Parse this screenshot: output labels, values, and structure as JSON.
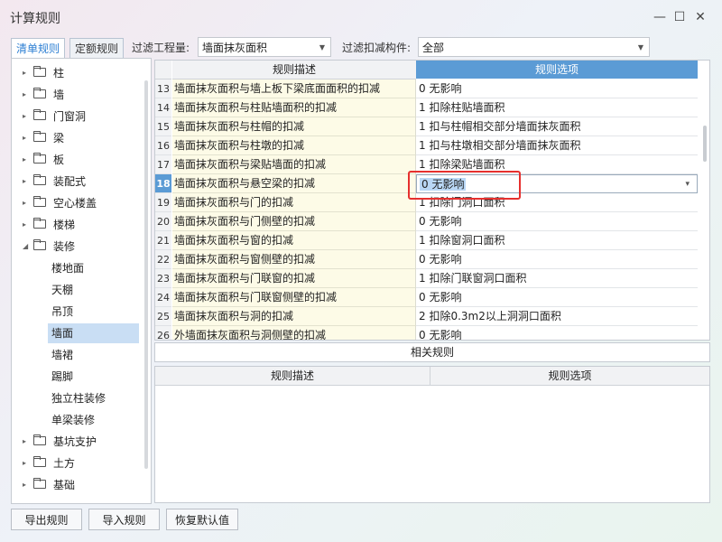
{
  "window": {
    "title": "计算规则",
    "min_icon": "minimize-icon",
    "max_icon": "maximize-icon",
    "close_icon": "close-icon"
  },
  "tabs": [
    {
      "label": "清单规则",
      "active": true
    },
    {
      "label": "定额规则",
      "active": false
    }
  ],
  "filters": {
    "quantity_label": "过滤工程量:",
    "quantity_value": "墙面抹灰面积",
    "deduct_label": "过滤扣减构件:",
    "deduct_value": "全部"
  },
  "tree": {
    "items": [
      {
        "label": "柱",
        "type": "folder",
        "expanded": false
      },
      {
        "label": "墙",
        "type": "folder",
        "expanded": false
      },
      {
        "label": "门窗洞",
        "type": "folder",
        "expanded": false
      },
      {
        "label": "梁",
        "type": "folder",
        "expanded": false
      },
      {
        "label": "板",
        "type": "folder",
        "expanded": false
      },
      {
        "label": "装配式",
        "type": "folder",
        "expanded": false
      },
      {
        "label": "空心楼盖",
        "type": "folder",
        "expanded": false
      },
      {
        "label": "楼梯",
        "type": "folder",
        "expanded": false
      },
      {
        "label": "装修",
        "type": "folder",
        "expanded": true
      },
      {
        "label": "楼地面",
        "type": "leaf"
      },
      {
        "label": "天棚",
        "type": "leaf"
      },
      {
        "label": "吊顶",
        "type": "leaf"
      },
      {
        "label": "墙面",
        "type": "leaf",
        "selected": true
      },
      {
        "label": "墙裙",
        "type": "leaf"
      },
      {
        "label": "踢脚",
        "type": "leaf"
      },
      {
        "label": "独立柱装修",
        "type": "leaf"
      },
      {
        "label": "单梁装修",
        "type": "leaf"
      },
      {
        "label": "基坑支护",
        "type": "folder",
        "expanded": false
      },
      {
        "label": "土方",
        "type": "folder",
        "expanded": false
      },
      {
        "label": "基础",
        "type": "folder",
        "expanded": false
      }
    ]
  },
  "grid": {
    "headers": {
      "desc": "规则描述",
      "option": "规则选项"
    },
    "rows": [
      {
        "num": "13",
        "desc": "墙面抹灰面积与墙上板下梁底面面积的扣减",
        "option": "0  无影响"
      },
      {
        "num": "14",
        "desc": "墙面抹灰面积与柱贴墙面积的扣减",
        "option": "1  扣除柱贴墙面积"
      },
      {
        "num": "15",
        "desc": "墙面抹灰面积与柱帽的扣减",
        "option": "1  扣与柱帽相交部分墙面抹灰面积"
      },
      {
        "num": "16",
        "desc": "墙面抹灰面积与柱墩的扣减",
        "option": "1  扣与柱墩相交部分墙面抹灰面积"
      },
      {
        "num": "17",
        "desc": "墙面抹灰面积与梁贴墙面的扣减",
        "option": "1  扣除梁贴墙面积"
      },
      {
        "num": "18",
        "desc": "墙面抹灰面积与悬空梁的扣减",
        "option": "0  无影响",
        "selected": true
      },
      {
        "num": "19",
        "desc": "墙面抹灰面积与门的扣减",
        "option": "1  扣除门洞口面积"
      },
      {
        "num": "20",
        "desc": "墙面抹灰面积与门侧壁的扣减",
        "option": "0  无影响"
      },
      {
        "num": "21",
        "desc": "墙面抹灰面积与窗的扣减",
        "option": "1  扣除窗洞口面积"
      },
      {
        "num": "22",
        "desc": "墙面抹灰面积与窗侧壁的扣减",
        "option": "0  无影响"
      },
      {
        "num": "23",
        "desc": "墙面抹灰面积与门联窗的扣减",
        "option": "1  扣除门联窗洞口面积"
      },
      {
        "num": "24",
        "desc": "墙面抹灰面积与门联窗侧壁的扣减",
        "option": "0  无影响"
      },
      {
        "num": "25",
        "desc": "墙面抹灰面积与洞的扣减",
        "option": "2  扣除0.3m2以上洞洞口面积"
      },
      {
        "num": "26",
        "desc": "外墙面抹灰面积与洞侧壁的扣减",
        "option": "0  无影响"
      }
    ]
  },
  "related": {
    "label": "相关规则",
    "headers": {
      "desc": "规则描述",
      "option": "规则选项"
    }
  },
  "buttons": {
    "export": "导出规则",
    "import": "导入规则",
    "restore": "恢复默认值"
  },
  "colors": {
    "accent": "#2d7fd3",
    "header_blue": "#5b9bd5",
    "highlight": "#e6302e"
  }
}
